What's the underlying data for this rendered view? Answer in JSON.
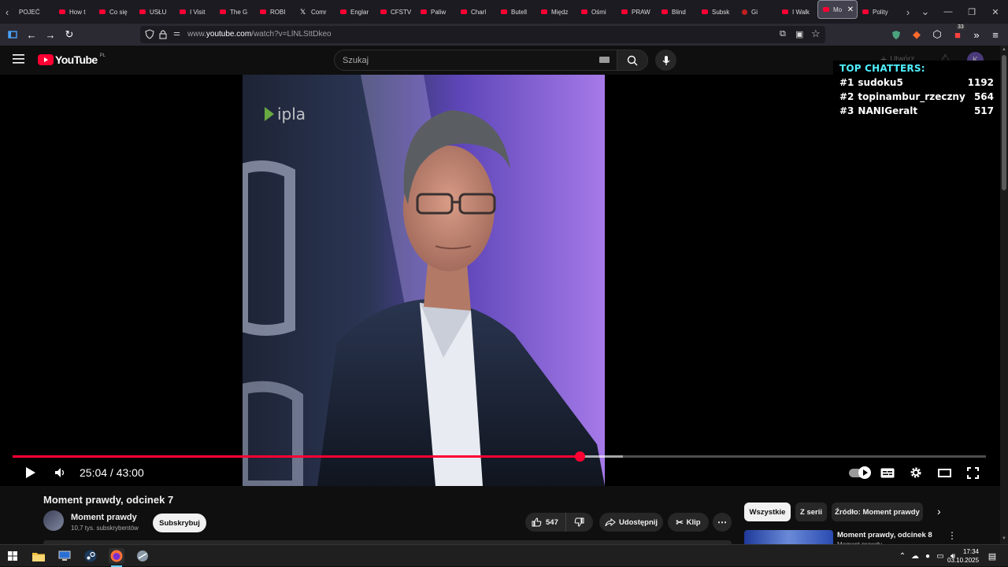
{
  "browser": {
    "tabs": [
      {
        "label": "POJEĆ",
        "icon": "none"
      },
      {
        "label": "How t",
        "icon": "youtube"
      },
      {
        "label": "Co się",
        "icon": "youtube"
      },
      {
        "label": "USŁU",
        "icon": "youtube"
      },
      {
        "label": "I Visit",
        "icon": "youtube"
      },
      {
        "label": "The G",
        "icon": "youtube"
      },
      {
        "label": "ROBI",
        "icon": "youtube"
      },
      {
        "label": "Comr",
        "icon": "x"
      },
      {
        "label": "Englar",
        "icon": "youtube"
      },
      {
        "label": "CFSTV",
        "icon": "youtube"
      },
      {
        "label": "Paliw",
        "icon": "youtube"
      },
      {
        "label": "Charl",
        "icon": "youtube"
      },
      {
        "label": "Butell",
        "icon": "youtube"
      },
      {
        "label": "Międz",
        "icon": "youtube"
      },
      {
        "label": "Ośmi",
        "icon": "youtube"
      },
      {
        "label": "PRAW",
        "icon": "youtube"
      },
      {
        "label": "Blind",
        "icon": "youtube"
      },
      {
        "label": "Subsk",
        "icon": "youtube"
      },
      {
        "label": "Gi",
        "icon": "generic"
      },
      {
        "label": "I Walk",
        "icon": "youtube"
      },
      {
        "label": "Mo",
        "icon": "youtube",
        "active": true
      },
      {
        "label": "Polity",
        "icon": "youtube"
      }
    ],
    "url_prefix": "www.",
    "url_domain": "youtube.com",
    "url_path": "/watch?v=LlNLSttDkeo",
    "extension_badge": "33"
  },
  "youtube": {
    "logo_text": "YouTube",
    "region": "PL",
    "search_placeholder": "Szukaj",
    "create_label": "Utwórz",
    "avatar_letter": "K"
  },
  "player": {
    "current_time": "25:04",
    "duration": "43:00",
    "time_display": "25:04 / 43:00",
    "progress_fraction": 0.583,
    "buffered_fraction": 0.627,
    "watermark": "ipla",
    "autoplay_on": true
  },
  "overlay": {
    "title": "TOP CHATTERS:",
    "chatters": [
      {
        "rank": "#1",
        "name": "sudoku5",
        "count": "1192"
      },
      {
        "rank": "#2",
        "name": "topinambur_rzeczny",
        "count": "564"
      },
      {
        "rank": "#3",
        "name": "NANIGeralt",
        "count": "517"
      }
    ]
  },
  "video": {
    "title": "Moment prawdy, odcinek 7",
    "channel_name": "Moment prawdy",
    "subscribers": "10,7 tys. subskrybentów",
    "subscribe_label": "Subskrybuj",
    "likes": "547",
    "share_label": "Udostępnij",
    "clip_label": "Klip"
  },
  "sidebar": {
    "chips": [
      "Wszystkie",
      "Z serii",
      "Źródło: Moment prawdy"
    ],
    "next_title": "Moment prawdy, odcinek 8",
    "next_channel": "Moment prawdy"
  },
  "taskbar": {
    "time": "17:34",
    "date": "03.10.2025"
  }
}
